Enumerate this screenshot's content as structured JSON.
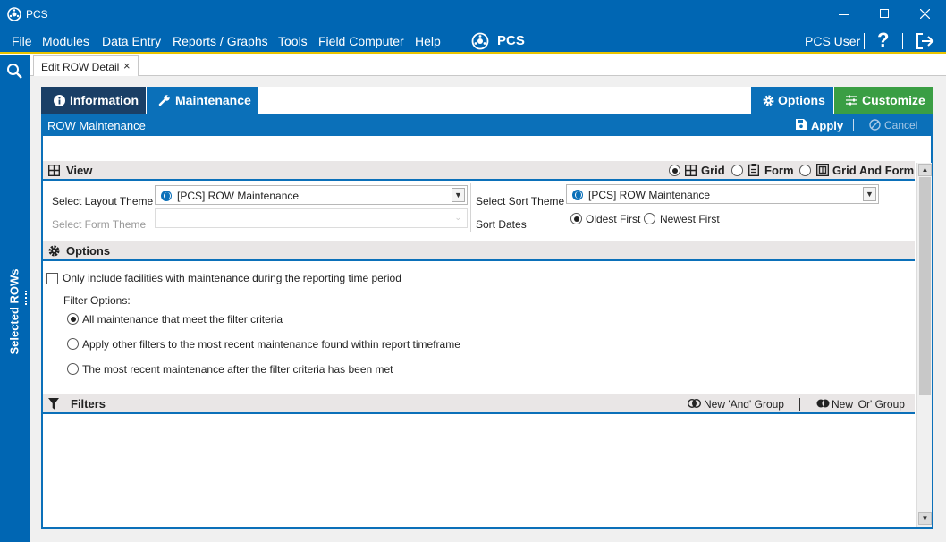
{
  "window": {
    "title": "PCS"
  },
  "menu": {
    "items": [
      "File",
      "Modules",
      "Data Entry",
      "Reports / Graphs",
      "Tools",
      "Field Computer",
      "Help"
    ],
    "center_title": "PCS",
    "user": "PCS User",
    "help_glyph": "?"
  },
  "sidebar": {
    "label": "Selected ROWs"
  },
  "doc_tab": {
    "label": "Edit ROW Detail",
    "close_glyph": "×"
  },
  "tabs": {
    "information": "Information",
    "maintenance": "Maintenance",
    "options": "Options",
    "customize": "Customize"
  },
  "subheader": {
    "title": "ROW Maintenance",
    "apply": "Apply",
    "cancel": "Cancel"
  },
  "view": {
    "title": "View",
    "modes": [
      "Grid",
      "Form",
      "Grid And Form"
    ],
    "selected_mode": "Grid",
    "layout_theme_label": "Select Layout Theme",
    "layout_theme_value": "[PCS] ROW Maintenance",
    "form_theme_label": "Select Form Theme",
    "form_theme_value": "",
    "sort_theme_label": "Select Sort Theme",
    "sort_theme_value": "[PCS] ROW Maintenance",
    "sort_dates_label": "Sort Dates",
    "sort_dates_options": [
      "Oldest First",
      "Newest First"
    ],
    "sort_dates_selected": "Oldest First"
  },
  "options": {
    "title": "Options",
    "only_include_label": "Only include facilities with maintenance during the reporting time period",
    "only_include_checked": false,
    "filter_options_label": "Filter Options:",
    "filter_choices": [
      "All maintenance that meet the filter criteria",
      "Apply other filters to the most recent maintenance found within report timeframe",
      "The most recent maintenance after the filter criteria has been met"
    ],
    "filter_selected": 0
  },
  "filters": {
    "title": "Filters",
    "new_and": "New 'And' Group",
    "new_or": "New 'Or' Group"
  },
  "colors": {
    "primary": "#0b70b9",
    "titlebar": "#0066b3",
    "accent_yellow": "#e9c400",
    "customize_green": "#3a9e44",
    "tab_dark": "#1a3f66"
  }
}
